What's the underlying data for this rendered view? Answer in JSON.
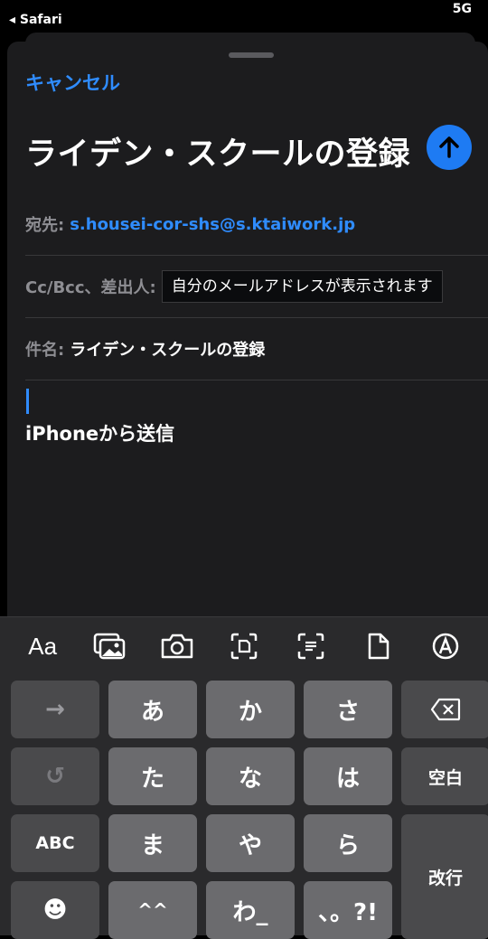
{
  "status_bar": {
    "back_app": "◂ Safari",
    "right": "5G"
  },
  "compose": {
    "cancel_label": "キャンセル",
    "title": "ライデン・スクールの登録",
    "to_label": "宛先:",
    "to_value": "s.housei-cor-shs@s.ktaiwork.jp",
    "cc_label": "Cc/Bcc、差出人:",
    "from_placeholder": "自分のメールアドレスが表示されます",
    "subject_label": "件名:",
    "subject_value": "ライデン・スクールの登録",
    "signature": "iPhoneから送信"
  },
  "keyboard": {
    "toolbar": [
      "Aa",
      "photo-library-icon",
      "camera-icon",
      "scan-text-icon",
      "scan-document-icon",
      "document-icon",
      "markup-icon"
    ],
    "row1": [
      "→",
      "あ",
      "か",
      "さ",
      "⌫"
    ],
    "row2": [
      "↺",
      "た",
      "な",
      "は",
      "空白"
    ],
    "row3": [
      "ABC",
      "ま",
      "や",
      "ら",
      "改行"
    ],
    "row4": [
      "☻",
      "^^",
      "わ_",
      "、。?!"
    ]
  },
  "colors": {
    "accent": "#2f8cff",
    "send_button": "#1e7bf3",
    "sheet": "#1c1c1e",
    "key": "#6b6b6e",
    "key_dark": "#4a4a4c"
  }
}
